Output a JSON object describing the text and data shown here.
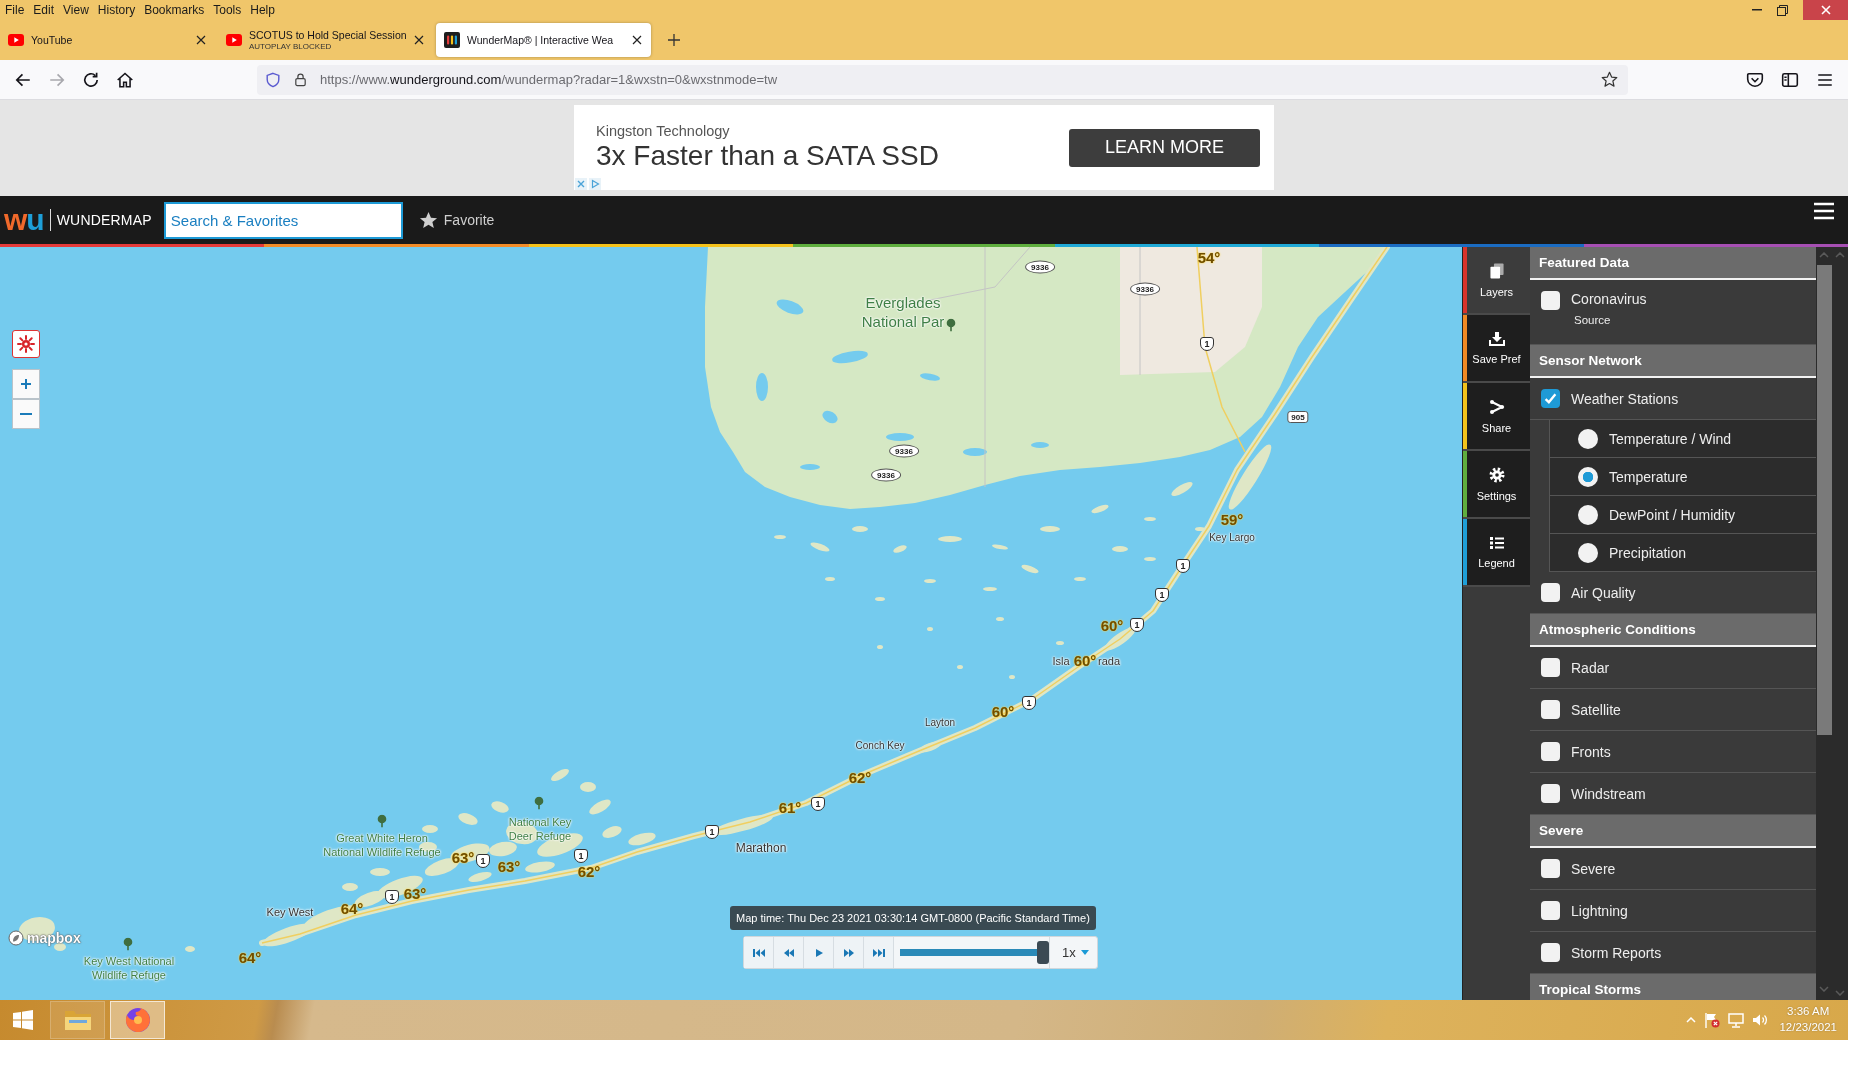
{
  "menu_bar": [
    "File",
    "Edit",
    "View",
    "History",
    "Bookmarks",
    "Tools",
    "Help"
  ],
  "tabs": [
    {
      "kind": "youtube",
      "title": "YouTube",
      "selected": false
    },
    {
      "kind": "youtube",
      "title": "SCOTUS to Hold Special Session",
      "subtitle": "AUTOPLAY BLOCKED",
      "selected": false
    },
    {
      "kind": "wunderground",
      "title": "WunderMap® | Interactive Wea",
      "selected": true
    }
  ],
  "address_bar": {
    "url_start": "https://www.",
    "url_domain": "wunderground.com",
    "url_rest": "/wundermap?radar=1&wxstn=0&wxstnmode=tw"
  },
  "ad": {
    "advertiser": "Kingston Technology",
    "headline": "3x Faster than a SATA SSD",
    "button": "LEARN MORE"
  },
  "header": {
    "logo": "wu",
    "brand": "WUNDERMAP",
    "search": {
      "placeholder": "Search & Favorites"
    },
    "favorite": "Favorite"
  },
  "map": {
    "places": [
      {
        "kind": "park",
        "lines": [
          "Everglades",
          "National Par"
        ]
      },
      {
        "kind": "town",
        "lines": [
          "Key Largo"
        ]
      },
      {
        "kind": "town",
        "lines": [
          "Isla"
        ]
      },
      {
        "kind": "town",
        "lines": [
          "rada"
        ]
      },
      {
        "kind": "town",
        "lines": [
          "Layton"
        ]
      },
      {
        "kind": "town",
        "lines": [
          "Conch Key"
        ]
      },
      {
        "kind": "town",
        "lines": [
          "Marathon"
        ]
      },
      {
        "kind": "park",
        "lines": [
          "National Key",
          "Deer Refuge"
        ]
      },
      {
        "kind": "park",
        "lines": [
          "Great White Heron",
          "National Wildlife Refuge"
        ]
      },
      {
        "kind": "town",
        "lines": [
          "Key West"
        ]
      },
      {
        "kind": "park",
        "lines": [
          "Key West National",
          "Wildlife Refuge"
        ]
      }
    ],
    "shields": [
      {
        "kind": "oval",
        "text": "9336"
      },
      {
        "kind": "oval",
        "text": "9336"
      },
      {
        "kind": "shield",
        "text": "1"
      },
      {
        "kind": "square",
        "text": "905"
      },
      {
        "kind": "oval",
        "text": "9336"
      },
      {
        "kind": "oval",
        "text": "9336"
      },
      {
        "kind": "shield",
        "text": "1"
      },
      {
        "kind": "shield",
        "text": "1"
      },
      {
        "kind": "shield",
        "text": "1"
      },
      {
        "kind": "shield",
        "text": "1"
      },
      {
        "kind": "shield",
        "text": "1"
      },
      {
        "kind": "shield",
        "text": "1"
      },
      {
        "kind": "shield",
        "text": "1"
      },
      {
        "kind": "shield",
        "text": "1"
      },
      {
        "kind": "shield",
        "text": "1"
      }
    ],
    "temperatures": [
      "54°",
      "59°",
      "60°",
      "60°",
      "60°",
      "62°",
      "61°",
      "62°",
      "63°",
      "63°",
      "63°",
      "64°",
      "64°"
    ],
    "attribution": "mapbox",
    "timeline": {
      "time_label": "Map time: Thu Dec 23 2021 03:30:14 GMT-0800 (Pacific Standard Time)",
      "level": 1,
      "speed": "1x"
    }
  },
  "side_tabs": [
    {
      "kind": "layers",
      "label": "Layers",
      "color": "#d9342b",
      "selected": true
    },
    {
      "kind": "save",
      "label": "Save Pref",
      "color": "#f08a24",
      "selected": false
    },
    {
      "kind": "share",
      "label": "Share",
      "color": "#f2c31b",
      "selected": false
    },
    {
      "kind": "settings",
      "label": "Settings",
      "color": "#5fae3e",
      "selected": false
    },
    {
      "kind": "legend",
      "label": "Legend",
      "color": "#1e9fd8",
      "selected": false
    }
  ],
  "layers": [
    {
      "title": "Featured Data",
      "items": [
        {
          "label": "Coronavirus",
          "sublabel": "Source",
          "checked": false
        }
      ]
    },
    {
      "title": "Sensor Network",
      "items": [
        {
          "label": "Weather Stations",
          "checked": true,
          "options": [
            {
              "label": "Temperature / Wind",
              "selected": false
            },
            {
              "label": "Temperature",
              "selected": true
            },
            {
              "label": "DewPoint / Humidity",
              "selected": false
            },
            {
              "label": "Precipitation",
              "selected": false
            }
          ]
        },
        {
          "label": "Air Quality",
          "checked": false
        }
      ]
    },
    {
      "title": "Atmospheric Conditions",
      "items": [
        {
          "label": "Radar",
          "checked": false
        },
        {
          "label": "Satellite",
          "checked": false
        },
        {
          "label": "Fronts",
          "checked": false
        },
        {
          "label": "Windstream",
          "checked": false
        }
      ]
    },
    {
      "title": "Severe",
      "items": [
        {
          "label": "Severe",
          "checked": false
        },
        {
          "label": "Lightning",
          "checked": false
        },
        {
          "label": "Storm Reports",
          "checked": false
        }
      ]
    },
    {
      "title": "Tropical Storms"
    }
  ],
  "taskbar": {
    "apps": [
      {
        "kind": "explorer",
        "selected": false
      },
      {
        "kind": "firefox",
        "selected": true
      }
    ],
    "time": "3:36 AM",
    "date": "12/23/2021"
  }
}
